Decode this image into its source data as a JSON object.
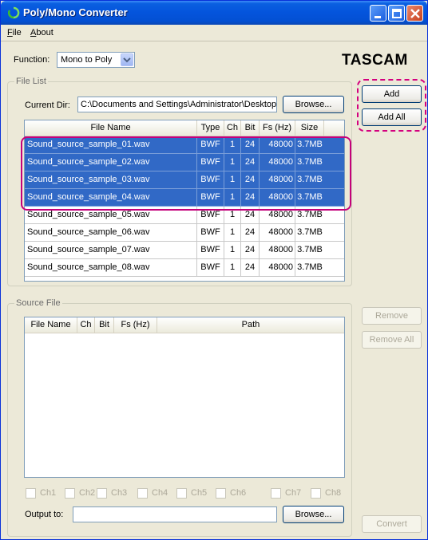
{
  "window": {
    "title": "Poly/Mono Converter"
  },
  "menu": {
    "file": "File",
    "about": "About"
  },
  "function": {
    "label": "Function:",
    "value": "Mono to Poly"
  },
  "brand": "TASCAM",
  "file_list": {
    "title": "File List",
    "current_dir_label": "Current Dir:",
    "current_dir_value": "C:\\Documents and Settings\\Administrator\\Desktop",
    "browse_label": "Browse...",
    "columns": [
      "File Name",
      "Type",
      "Ch",
      "Bit",
      "Fs (Hz)",
      "Size"
    ],
    "rows": [
      {
        "name": "Sound_source_sample_01.wav",
        "type": "BWF",
        "ch": "1",
        "bit": "24",
        "fs": "48000",
        "size": "3.7MB",
        "selected": true
      },
      {
        "name": "Sound_source_sample_02.wav",
        "type": "BWF",
        "ch": "1",
        "bit": "24",
        "fs": "48000",
        "size": "3.7MB",
        "selected": true
      },
      {
        "name": "Sound_source_sample_03.wav",
        "type": "BWF",
        "ch": "1",
        "bit": "24",
        "fs": "48000",
        "size": "3.7MB",
        "selected": true
      },
      {
        "name": "Sound_source_sample_04.wav",
        "type": "BWF",
        "ch": "1",
        "bit": "24",
        "fs": "48000",
        "size": "3.7MB",
        "selected": true
      },
      {
        "name": "Sound_source_sample_05.wav",
        "type": "BWF",
        "ch": "1",
        "bit": "24",
        "fs": "48000",
        "size": "3.7MB",
        "selected": false
      },
      {
        "name": "Sound_source_sample_06.wav",
        "type": "BWF",
        "ch": "1",
        "bit": "24",
        "fs": "48000",
        "size": "3.7MB",
        "selected": false
      },
      {
        "name": "Sound_source_sample_07.wav",
        "type": "BWF",
        "ch": "1",
        "bit": "24",
        "fs": "48000",
        "size": "3.7MB",
        "selected": false
      },
      {
        "name": "Sound_source_sample_08.wav",
        "type": "BWF",
        "ch": "1",
        "bit": "24",
        "fs": "48000",
        "size": "3.7MB",
        "selected": false
      }
    ]
  },
  "side_buttons": {
    "add": "Add",
    "add_all": "Add All",
    "remove": "Remove",
    "remove_all": "Remove All",
    "convert": "Convert"
  },
  "source_file": {
    "title": "Source File",
    "columns": [
      "File Name",
      "Ch",
      "Bit",
      "Fs (Hz)",
      "Path"
    ],
    "channels": [
      "Ch1",
      "Ch2",
      "Ch3",
      "Ch4",
      "Ch5",
      "Ch6",
      "Ch7",
      "Ch8"
    ],
    "output_label": "Output to:",
    "output_value": "",
    "browse_label": "Browse..."
  },
  "colors": {
    "selection": "#3169c6",
    "highlight": "#c5007a",
    "title_bar": "#0454dc"
  }
}
